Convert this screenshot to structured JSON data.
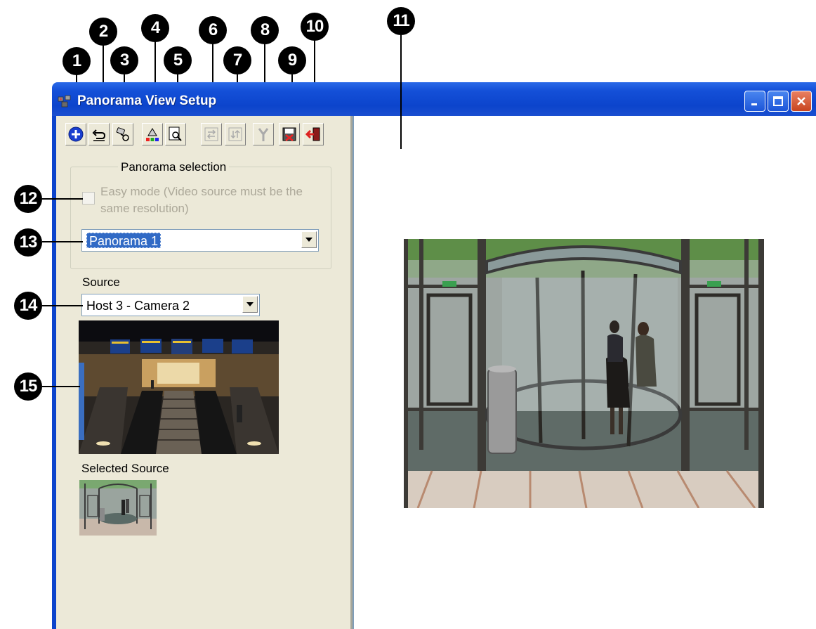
{
  "window": {
    "title": "Panorama View Setup"
  },
  "toolbar": {
    "buttons": [
      {
        "icon": "add-icon"
      },
      {
        "icon": "undo-icon"
      },
      {
        "icon": "camera-link-icon"
      },
      {
        "icon": "color-fill-icon"
      },
      {
        "icon": "preview-zoom-icon"
      },
      {
        "icon": "align-horizontal-icon"
      },
      {
        "icon": "align-vertical-icon"
      },
      {
        "icon": "split-icon"
      },
      {
        "icon": "save-icon"
      },
      {
        "icon": "exit-icon"
      }
    ]
  },
  "panorama_selection": {
    "group_label": "Panorama selection",
    "easy_mode_label": "Easy mode (Video source must be the same resolution)",
    "easy_mode_checked": false,
    "panorama_value": "Panorama 1"
  },
  "source": {
    "label": "Source",
    "value": "Host 3 - Camera 2"
  },
  "selected_source": {
    "label": "Selected Source"
  },
  "callouts": [
    "1",
    "2",
    "3",
    "4",
    "5",
    "6",
    "7",
    "8",
    "9",
    "10",
    "11",
    "12",
    "13",
    "14",
    "15"
  ],
  "colors": {
    "titlebar": "#0c44cc",
    "pane_bg": "#ece9d8",
    "selection": "#316ac5",
    "close_button": "#c8451f"
  }
}
